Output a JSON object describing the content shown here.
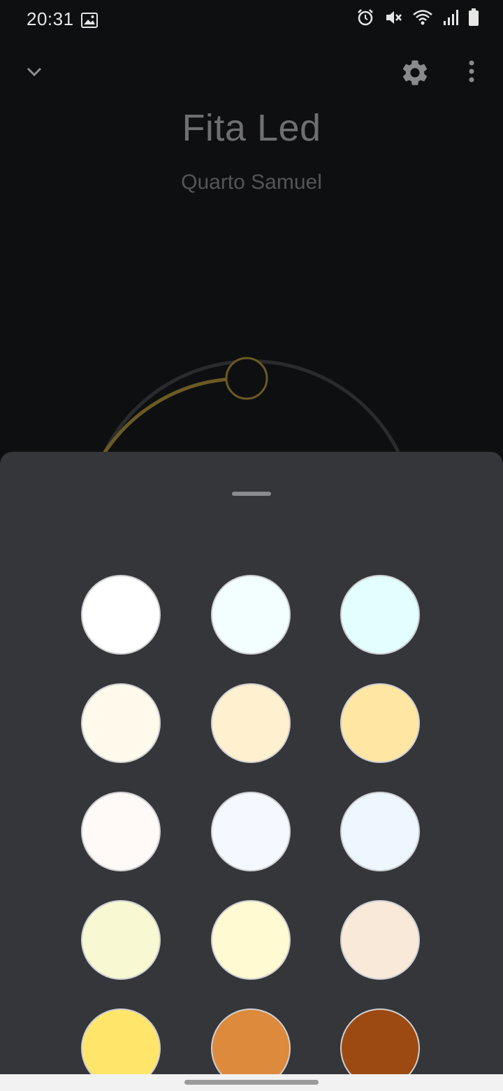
{
  "status_bar": {
    "time": "20:31",
    "icons": [
      "image-icon",
      "alarm-icon",
      "mute-icon",
      "wifi-icon",
      "signal-icon",
      "battery-icon"
    ]
  },
  "toolbar": {
    "back_icon": "chevron-down-icon",
    "settings_icon": "gear-icon",
    "menu_icon": "more-vert-icon"
  },
  "device": {
    "name": "Fita Led",
    "room": "Quarto Samuel"
  },
  "dial": {
    "accent_color": "#6b5a24",
    "track_color": "#2a2b2d"
  },
  "sheet": {
    "background": "#35363a",
    "swatches": [
      {
        "color": "#ffffff"
      },
      {
        "color": "#f3feff"
      },
      {
        "color": "#e3feff"
      },
      {
        "color": "#fffaeb"
      },
      {
        "color": "#fff0cf"
      },
      {
        "color": "#ffe7a3"
      },
      {
        "color": "#fff9f8"
      },
      {
        "color": "#f5f8ff"
      },
      {
        "color": "#eef6ff"
      },
      {
        "color": "#f8f9d3"
      },
      {
        "color": "#fffad1"
      },
      {
        "color": "#f9e9d9"
      },
      {
        "color": "#ffe56a"
      },
      {
        "color": "#dd8a3c"
      },
      {
        "color": "#9c4a12"
      }
    ]
  }
}
